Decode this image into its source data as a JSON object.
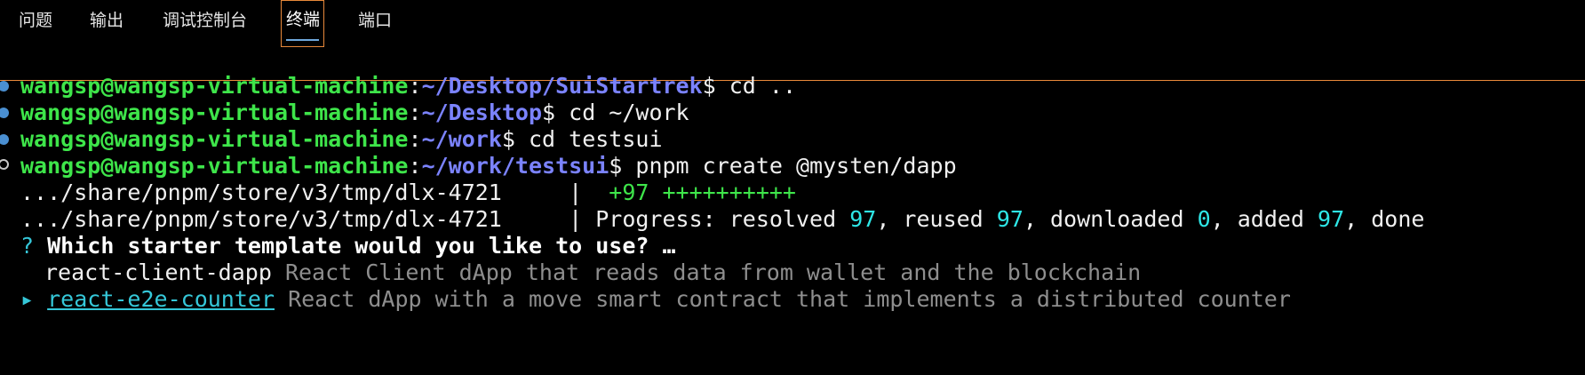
{
  "tabs": [
    {
      "label": "问题"
    },
    {
      "label": "输出"
    },
    {
      "label": "调试控制台"
    },
    {
      "label": "终端",
      "active": true
    },
    {
      "label": "端口"
    }
  ],
  "terminal": {
    "prompts": [
      {
        "user": "wangsp@wangsp-virtual-machine",
        "sep": ":",
        "path": "~/Desktop/SuiStartrek",
        "dollar": "$ ",
        "cmd": "cd .."
      },
      {
        "user": "wangsp@wangsp-virtual-machine",
        "sep": ":",
        "path": "~/Desktop",
        "dollar": "$ ",
        "cmd": "cd ~/work"
      },
      {
        "user": "wangsp@wangsp-virtual-machine",
        "sep": ":",
        "path": "~/work",
        "dollar": "$ ",
        "cmd": "cd testsui"
      },
      {
        "user": "wangsp@wangsp-virtual-machine",
        "sep": ":",
        "path": "~/work/testsui",
        "dollar": "$ ",
        "cmd": "pnpm create @mysten/dapp"
      }
    ],
    "output1": {
      "path": ".../share/pnpm/store/v3/tmp/dlx-4721     |  ",
      "progress": "+97 ++++++++++"
    },
    "output2": {
      "path": ".../share/pnpm/store/v3/tmp/dlx-4721     | ",
      "label_progress": "Progress: resolved ",
      "resolved": "97",
      "label_reused": ", reused ",
      "reused": "97",
      "label_downloaded": ", downloaded ",
      "downloaded": "0",
      "label_added": ", added ",
      "added": "97",
      "label_done": ", done"
    },
    "question": {
      "mark": "?",
      "text": "Which starter template would you like to use? …"
    },
    "options": [
      {
        "name": "react-client-dapp",
        "desc": "React Client dApp that reads data from wallet and the blockchain",
        "selected": false
      },
      {
        "name": "react-e2e-counter",
        "desc": "React dApp with a move smart contract that implements a distributed counter",
        "selected": true
      }
    ],
    "selector_glyph": "▸"
  },
  "colors": {
    "accent_border": "#e8893a",
    "user_green": "#3ee54a",
    "path_blue": "#7b83ff",
    "number_cyan": "#2ee6e6",
    "dim_text": "#8e8e8e"
  }
}
